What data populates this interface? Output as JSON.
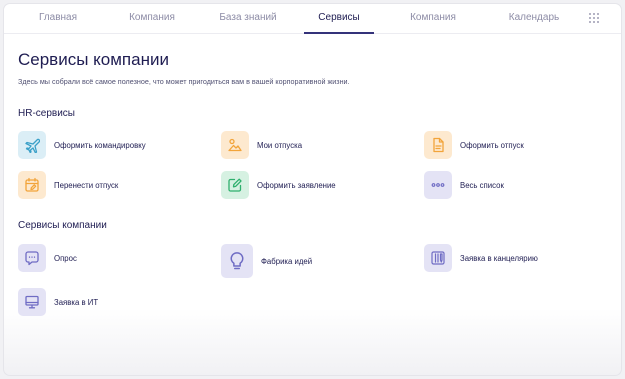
{
  "nav": {
    "tabs": [
      {
        "label": "Главная",
        "active": false
      },
      {
        "label": "Компания",
        "active": false
      },
      {
        "label": "База знаний",
        "active": false
      },
      {
        "label": "Сервисы",
        "active": true
      },
      {
        "label": "Компания",
        "active": false
      },
      {
        "label": "Календарь",
        "active": false
      }
    ],
    "apps_icon": "grid-dots-icon"
  },
  "page": {
    "title": "Сервисы компании",
    "subtitle": "Здесь мы собрали всё самое полезное, что может пригодиться вам в вашей корпоративной жизни."
  },
  "hr_section": {
    "title": "HR-сервисы",
    "items": [
      {
        "label": "Оформить командировку",
        "icon": "airplane-icon",
        "color": "#dbeef6"
      },
      {
        "label": "Мои отпуска",
        "icon": "sun-mountain-icon",
        "color": "#fde9cf"
      },
      {
        "label": "Оформить отпуск",
        "icon": "document-icon",
        "color": "#fde9cf"
      },
      {
        "label": "Перенести отпуск",
        "icon": "calendar-edit-icon",
        "color": "#fde9cf"
      },
      {
        "label": "Оформить заявление",
        "icon": "pencil-square-icon",
        "color": "#d6f1e2"
      },
      {
        "label": "Весь список",
        "icon": "more-dots-icon",
        "color": "#e4e3f5"
      }
    ]
  },
  "company_section": {
    "title": "Сервисы компании",
    "items": [
      {
        "label": "Опрос",
        "icon": "survey-chat-icon",
        "color": "#e4e3f5"
      },
      {
        "label": "Фабрика идей",
        "icon": "lightbulb-icon",
        "color": "#e4e3f5"
      },
      {
        "label": "Заявка в канцелярию",
        "icon": "stationery-icon",
        "color": "#e4e3f5"
      },
      {
        "label": "Заявка в ИТ",
        "icon": "monitor-icon",
        "color": "#e4e3f5"
      }
    ]
  },
  "colors": {
    "accent": "#34327a",
    "text": "#1f1d52",
    "icon_blue": "#3aa0c8",
    "icon_orange": "#f2a43a",
    "icon_green": "#2fb06e",
    "icon_purple": "#6f6cc4"
  }
}
